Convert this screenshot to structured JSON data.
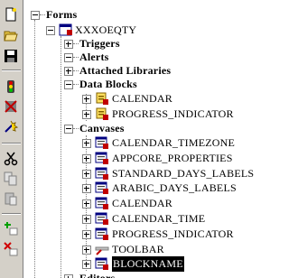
{
  "toolbar": {
    "buttons": [
      {
        "name": "new-icon"
      },
      {
        "name": "open-icon"
      },
      {
        "name": "save-icon"
      },
      {
        "name": "run-icon"
      },
      {
        "name": "debug-icon"
      },
      {
        "name": "compile-icon"
      },
      {
        "name": "cut-icon"
      },
      {
        "name": "copy-icon"
      },
      {
        "name": "paste-icon"
      },
      {
        "name": "create-icon"
      },
      {
        "name": "delete-icon"
      }
    ]
  },
  "tree": {
    "root": {
      "label": "Forms"
    },
    "module": {
      "label": "XXXOEQTY"
    },
    "triggers": {
      "label": "Triggers"
    },
    "alerts": {
      "label": "Alerts"
    },
    "attached_libraries": {
      "label": "Attached Libraries"
    },
    "data_blocks": {
      "label": "Data Blocks",
      "items": [
        {
          "label": "CALENDAR"
        },
        {
          "label": "PROGRESS_INDICATOR"
        }
      ]
    },
    "canvases": {
      "label": "Canvases",
      "items": [
        {
          "label": "CALENDAR_TIMEZONE"
        },
        {
          "label": "APPCORE_PROPERTIES"
        },
        {
          "label": "STANDARD_DAYS_LABELS"
        },
        {
          "label": "ARABIC_DAYS_LABELS"
        },
        {
          "label": "CALENDAR"
        },
        {
          "label": "CALENDAR_TIME"
        },
        {
          "label": "PROGRESS_INDICATOR"
        },
        {
          "label": "TOOLBAR"
        },
        {
          "label": "BLOCKNAME"
        }
      ]
    },
    "partial_bottom": {
      "label": "Editors"
    }
  },
  "colors": {
    "toolbar_bg": "#d4d0c8",
    "selection_bg": "#000000",
    "selection_fg": "#ffffff"
  }
}
